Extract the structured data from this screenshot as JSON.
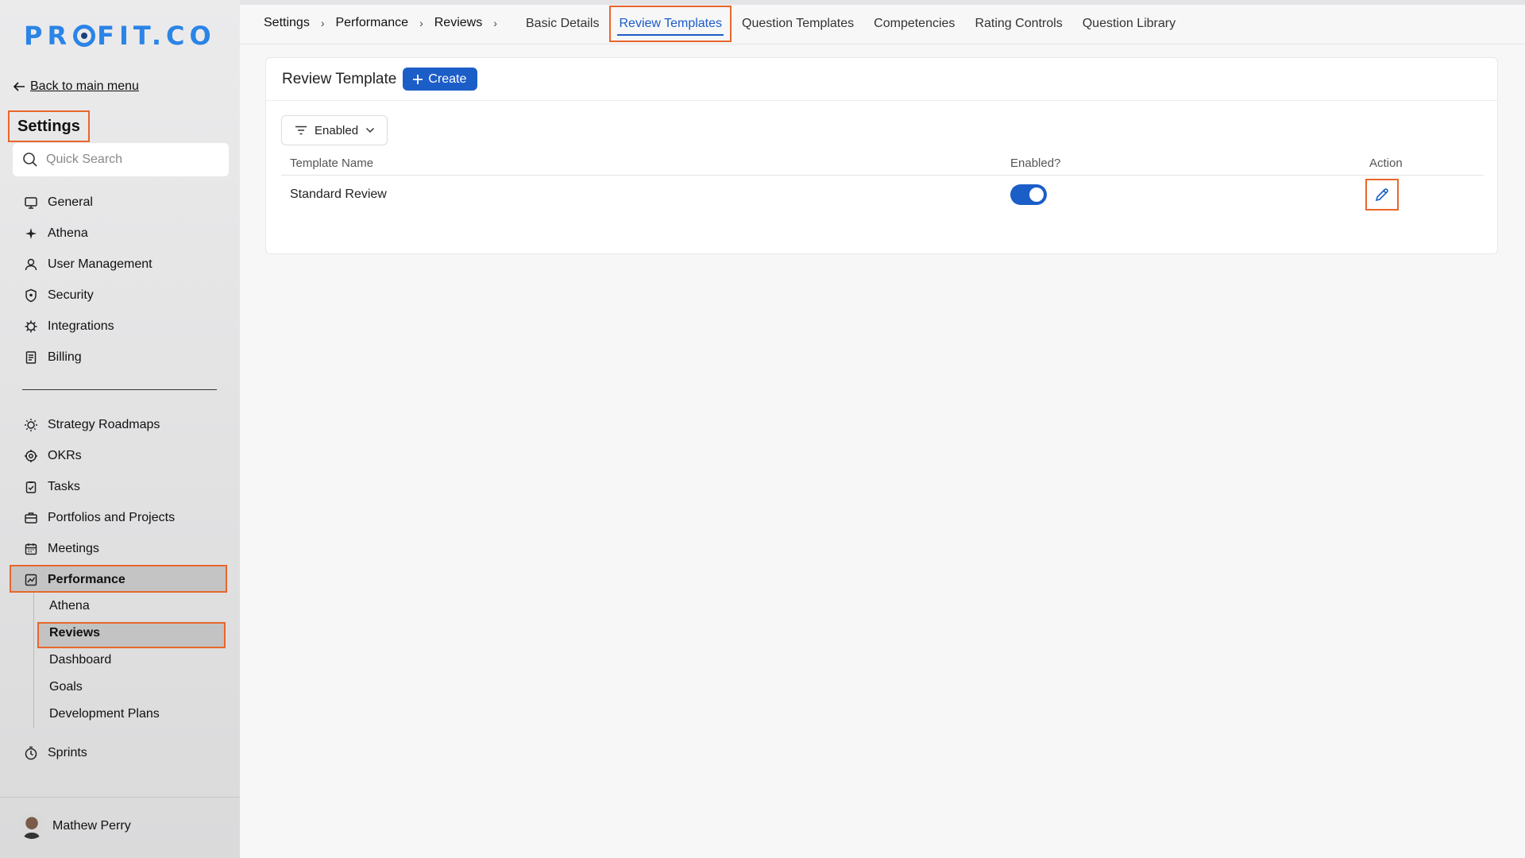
{
  "logo": {
    "text_before": "PR",
    "text_after": "FIT.CO"
  },
  "sidebar": {
    "back_label": "Back to main menu",
    "title": "Settings",
    "search_placeholder": "Quick Search",
    "group1": [
      {
        "label": "General",
        "icon": "monitor-icon"
      },
      {
        "label": "Athena",
        "icon": "sparkle-icon"
      },
      {
        "label": "User Management",
        "icon": "user-icon"
      },
      {
        "label": "Security",
        "icon": "shield-icon"
      },
      {
        "label": "Integrations",
        "icon": "puzzle-icon"
      },
      {
        "label": "Billing",
        "icon": "receipt-icon"
      }
    ],
    "group2": [
      {
        "label": "Strategy Roadmaps",
        "icon": "lightbulb-icon"
      },
      {
        "label": "OKRs",
        "icon": "target-icon"
      },
      {
        "label": "Tasks",
        "icon": "clipboard-check-icon"
      },
      {
        "label": "Portfolios and Projects",
        "icon": "briefcase-icon"
      },
      {
        "label": "Meetings",
        "icon": "calendar-icon"
      },
      {
        "label": "Performance",
        "icon": "chart-icon"
      }
    ],
    "performance_sub": [
      "Athena",
      "Reviews",
      "Dashboard",
      "Goals",
      "Development Plans"
    ],
    "sprints": {
      "label": "Sprints",
      "icon": "timer-icon"
    },
    "user_name": "Mathew Perry"
  },
  "breadcrumb": [
    "Settings",
    "Performance",
    "Reviews"
  ],
  "tabs": [
    "Basic Details",
    "Review Templates",
    "Question Templates",
    "Competencies",
    "Rating Controls",
    "Question Library"
  ],
  "active_tab": "Review Templates",
  "card": {
    "title": "Review Template",
    "create_label": "Create",
    "filter_label": "Enabled"
  },
  "table": {
    "headers": [
      "Template Name",
      "Enabled?",
      "Action"
    ],
    "rows": [
      {
        "name": "Standard Review",
        "enabled": true
      }
    ]
  },
  "colors": {
    "accent": "#1c5ec8",
    "highlight": "#e8662c",
    "logo": "#2b84e6"
  }
}
